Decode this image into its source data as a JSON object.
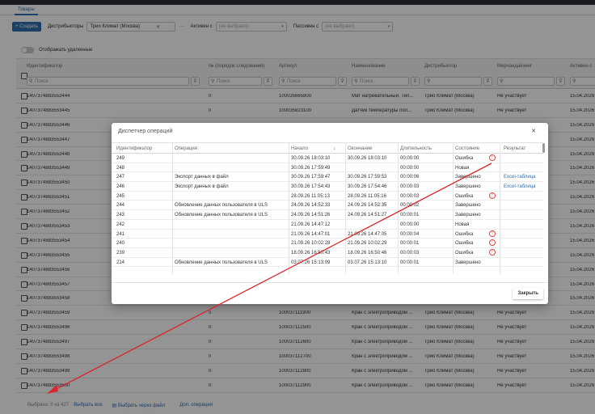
{
  "header": {
    "tab": "Товары"
  },
  "toolbar": {
    "create_label": "+ Создать",
    "distributors_label": "Дистрибьюторы",
    "distributor_value": "Трио Климат (Москва)",
    "active_label": "Активен с",
    "active_placeholder": "(не выбрано)",
    "passive_label": "Пассивен с",
    "passive_placeholder": "(не выбрано)"
  },
  "toggle": {
    "label": "Отображать удаленные"
  },
  "grid": {
    "headers": [
      "Идентификатор",
      "№ (порядок следования)",
      "Артикул",
      "Наименование",
      "Дистрибьютор",
      "Мерчандайзинг",
      "Активен с"
    ],
    "filter_placeholder": "Поиск",
    "rows": [
      [
        "1407374883553444",
        "0",
        "100035665800",
        "Мат нагревательный, Теп...",
        "Трио Климат (Москва)",
        "Не участвует",
        "15.04.2026"
      ],
      [
        "1407374883553445",
        "0",
        "100035823100",
        "Датчик температуры пол...",
        "Трио Климат (Москва)",
        "Не участвует",
        "15.04.2026"
      ],
      [
        "1407374883553446",
        "",
        "",
        "",
        "",
        "",
        "15.04.2026"
      ],
      [
        "1407374883553447",
        "",
        "",
        "",
        "",
        "",
        "15.04.2026"
      ],
      [
        "1407374883553448",
        "",
        "",
        "",
        "",
        "",
        "15.04.2026"
      ],
      [
        "1407374883553449",
        "",
        "",
        "",
        "",
        "",
        "15.04.2026"
      ],
      [
        "1407374883553450",
        "",
        "",
        "",
        "",
        "",
        "15.04.2026"
      ],
      [
        "1407374883553451",
        "",
        "",
        "",
        "",
        "",
        "15.04.2026"
      ],
      [
        "1407374883553452",
        "",
        "",
        "",
        "",
        "",
        "15.04.2026"
      ],
      [
        "1407374883553453",
        "",
        "",
        "",
        "",
        "",
        "15.04.2026"
      ],
      [
        "1407374883553454",
        "",
        "",
        "",
        "",
        "",
        "15.04.2026"
      ],
      [
        "1407374883553455",
        "",
        "",
        "",
        "",
        "",
        "15.04.2026"
      ],
      [
        "1407374883553456",
        "",
        "",
        "",
        "",
        "",
        "15.04.2026"
      ],
      [
        "1407374883553457",
        "",
        "",
        "",
        "",
        "",
        "15.04.2026"
      ],
      [
        "1407374883553458",
        "",
        "",
        "",
        "",
        "",
        "15.04.2026"
      ],
      [
        "1407374883553459",
        "0",
        "100037111900",
        "Кран с электроприводом ...",
        "Трио Климат (Москва)",
        "Не участвует",
        "15.04.2026"
      ],
      [
        "1407374883553496",
        "0",
        "100037112500",
        "Кран с электроприводом ...",
        "Трио Климат (Москва)",
        "Не участвует",
        "15.04.2026"
      ],
      [
        "1407374883553497",
        "0",
        "100037112600",
        "Кран с электроприводом ...",
        "Трио Климат (Москва)",
        "Не участвует",
        "15.04.2026"
      ],
      [
        "1407374883553498",
        "0",
        "100037112700",
        "Кран с электроприводом ...",
        "Трио Климат (Москва)",
        "Не участвует",
        "15.04.2026"
      ],
      [
        "1407374883553499",
        "0",
        "100037112800",
        "Кран с электроприводом ...",
        "Трио Климат (Москва)",
        "Не участвует",
        "15.04.2026"
      ],
      [
        "1407374883553500",
        "0",
        "100037112900",
        "Кран с электроприводом ...",
        "Трио Климат (Москва)",
        "Не участвует",
        "15.04.2026"
      ]
    ]
  },
  "footer": {
    "selected": "Выбрано: 0 из 427",
    "select_all": "Выбрать все",
    "select_file": "Выбрать через файл",
    "extra_ops": "Доп. операции"
  },
  "modal": {
    "title": "Диспетчер операций",
    "headers": [
      "Идентификатор",
      "Операция",
      "Начало",
      "Окончание",
      "Длительность",
      "Состояние",
      "Результат"
    ],
    "rows": [
      {
        "id": "249",
        "op": "",
        "start": "30.09.26 18:03:10",
        "end": "30.09.26 18:03:10",
        "dur": "00:00:00",
        "state": "Ошибка",
        "err": true,
        "result": ""
      },
      {
        "id": "248",
        "op": "",
        "start": "30.09.26 17:59:49",
        "end": "",
        "dur": "00:00:00",
        "state": "Новая",
        "err": false,
        "result": ""
      },
      {
        "id": "247",
        "op": "Экспорт данных в файл",
        "start": "30.09.26 17:59:47",
        "end": "30.09.26 17:59:53",
        "dur": "00:00:06",
        "state": "Завершено",
        "err": false,
        "result": "Excel-таблица"
      },
      {
        "id": "246",
        "op": "Экспорт данных в файл",
        "start": "30.09.26 17:54:43",
        "end": "30.09.26 17:54:46",
        "dur": "00:00:03",
        "state": "Завершено",
        "err": false,
        "result": "Excel-таблица"
      },
      {
        "id": "245",
        "op": "",
        "start": "28.09.26 11:05:13",
        "end": "28.09.26 11:05:16",
        "dur": "00:00:03",
        "state": "Ошибка",
        "err": true,
        "result": ""
      },
      {
        "id": "244",
        "op": "Обновление данных пользователя в ULS",
        "start": "24.09.26 14:52:33",
        "end": "24.09.26 14:52:35",
        "dur": "00:00:02",
        "state": "Завершено",
        "err": false,
        "result": ""
      },
      {
        "id": "243",
        "op": "Обновление данных пользователя в ULS",
        "start": "24.09.26 14:51:26",
        "end": "24.09.26 14:51:27",
        "dur": "00:00:01",
        "state": "Завершено",
        "err": false,
        "result": ""
      },
      {
        "id": "242",
        "op": "",
        "start": "21.09.26 14:47:12",
        "end": "",
        "dur": "00:00:00",
        "state": "Новая",
        "err": false,
        "result": ""
      },
      {
        "id": "241",
        "op": "",
        "start": "21.09.26 14:47:01",
        "end": "21.09.26 14:47:05",
        "dur": "00:00:04",
        "state": "Ошибка",
        "err": true,
        "result": ""
      },
      {
        "id": "240",
        "op": "",
        "start": "21.09.26 10:02:28",
        "end": "21.09.26 10:02:29",
        "dur": "00:00:01",
        "state": "Ошибка",
        "err": true,
        "result": ""
      },
      {
        "id": "239",
        "op": "",
        "start": "18.09.26 16:50:43",
        "end": "18.09.26 16:50:46",
        "dur": "00:00:03",
        "state": "Ошибка",
        "err": true,
        "result": ""
      },
      {
        "id": "214",
        "op": "Обновление данных пользователя в ULS",
        "start": "03.07.26 15:13:09",
        "end": "03.07.26 15:13:10",
        "dur": "00:00:01",
        "state": "Завершено",
        "err": false,
        "result": ""
      }
    ],
    "close_label": "Закрыть"
  },
  "colors": {
    "accent": "#2f6fb0",
    "error": "#e0453f",
    "arrow": "#d9262b"
  }
}
